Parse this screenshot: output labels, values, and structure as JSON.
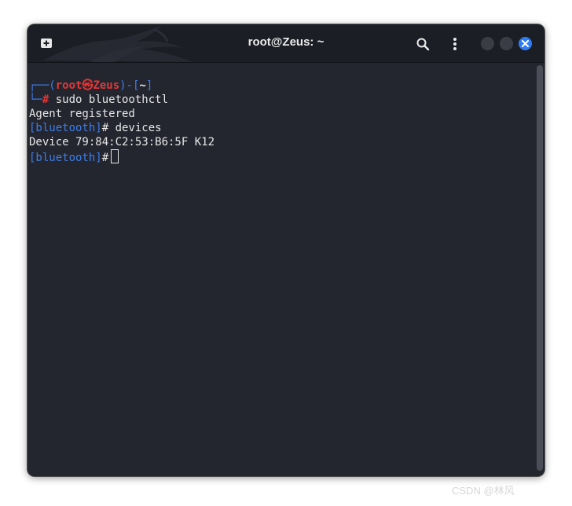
{
  "window": {
    "title": "root@Zeus: ~"
  },
  "icons": {
    "new_tab": "new-tab-icon",
    "search": "search-icon",
    "menu": "kebab-menu-icon",
    "close": "close-icon",
    "background": "kali-dragon-icon"
  },
  "colors": {
    "prompt_blue": "#3d7de8",
    "prompt_red": "#e63636",
    "close_button": "#2e7df4",
    "terminal_bg": "#24262f"
  },
  "terminal": {
    "prompt_line": {
      "box_top_left": "┌──(",
      "user": "root",
      "at_symbol": "㉿",
      "host": "Zeus",
      "mid": ")-[",
      "cwd": "~",
      "box_close": "]"
    },
    "command_line": {
      "box_bottom_left": "└─",
      "hash": "#",
      "command": " sudo bluetoothctl"
    },
    "output1": "Agent registered",
    "bt_prompt1": "[bluetooth]",
    "bt_cmd1": "# devices",
    "output2": "Device 79:84:C2:53:B6:5F K12",
    "bt_prompt2": "[bluetooth]",
    "bt_hash2": "#"
  },
  "watermark": "CSDN @林风"
}
